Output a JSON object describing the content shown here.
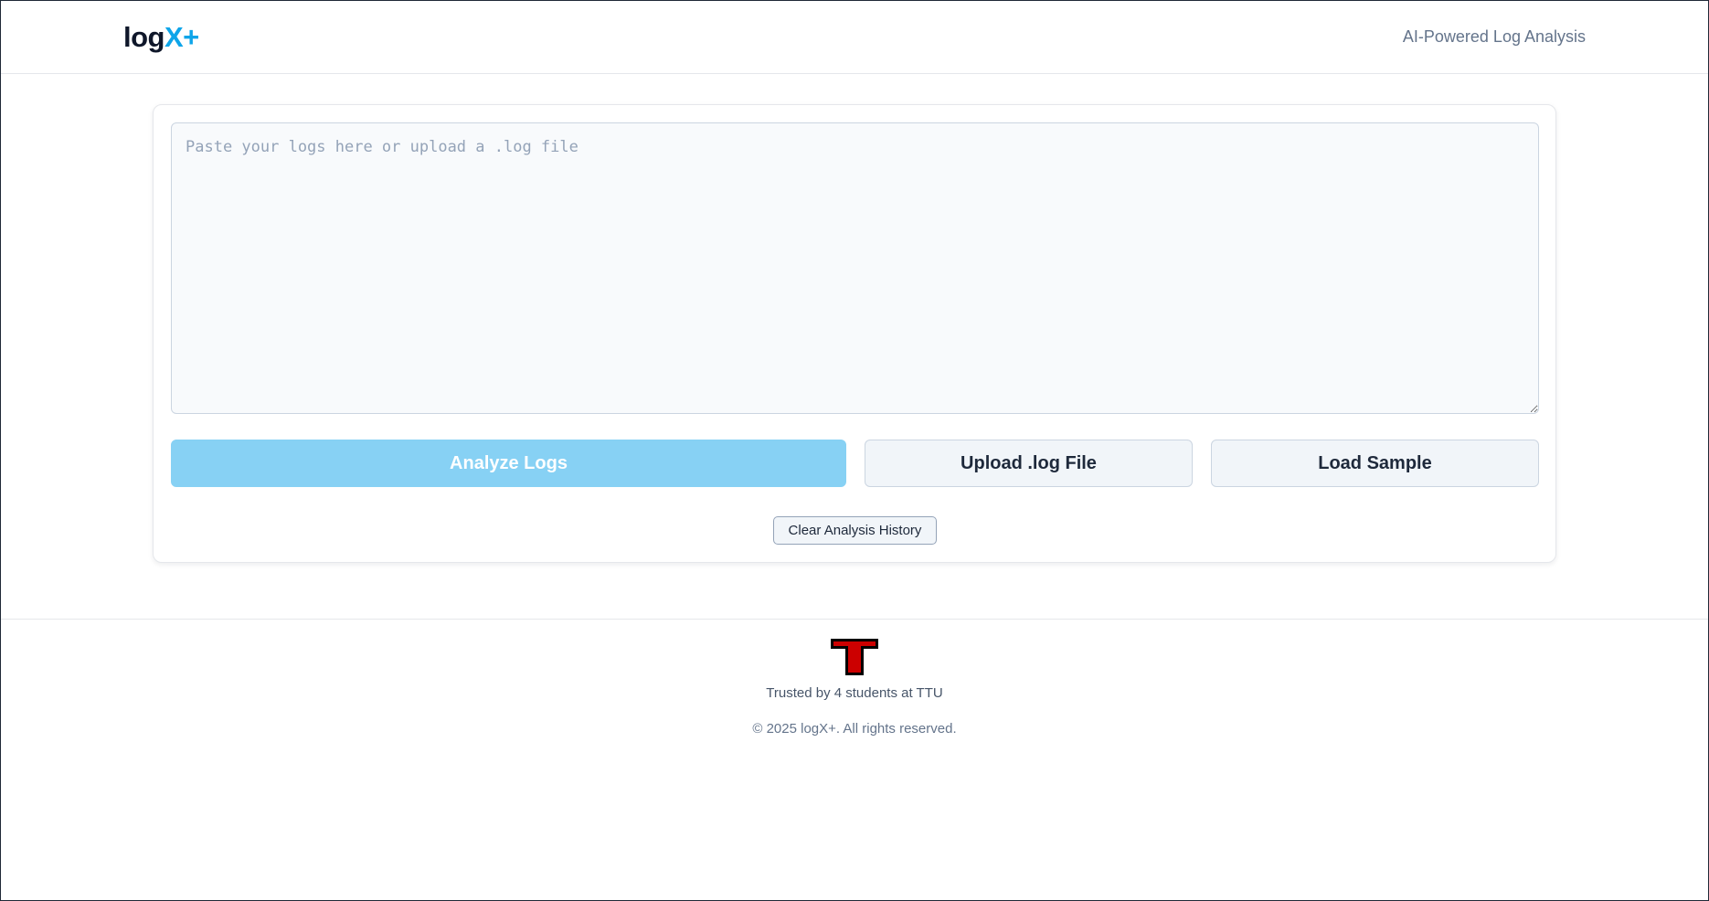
{
  "header": {
    "logo_main": "log",
    "logo_accent": "X+",
    "tagline": "AI-Powered Log Analysis"
  },
  "analyzer": {
    "log_input_value": "",
    "log_input_placeholder": "Paste your logs here or upload a .log file",
    "analyze_label": "Analyze Logs",
    "upload_label": "Upload .log File",
    "sample_label": "Load Sample",
    "clear_history_label": "Clear Analysis History"
  },
  "footer": {
    "logo_icon": "ttu-t-logo",
    "trusted_text": "Trusted by 4 students at TTU",
    "copyright": "© 2025 logX+. All rights reserved."
  },
  "colors": {
    "accent": "#0ea5e9",
    "primary_button": "#87d1f4",
    "ttu_red": "#cc0000"
  }
}
